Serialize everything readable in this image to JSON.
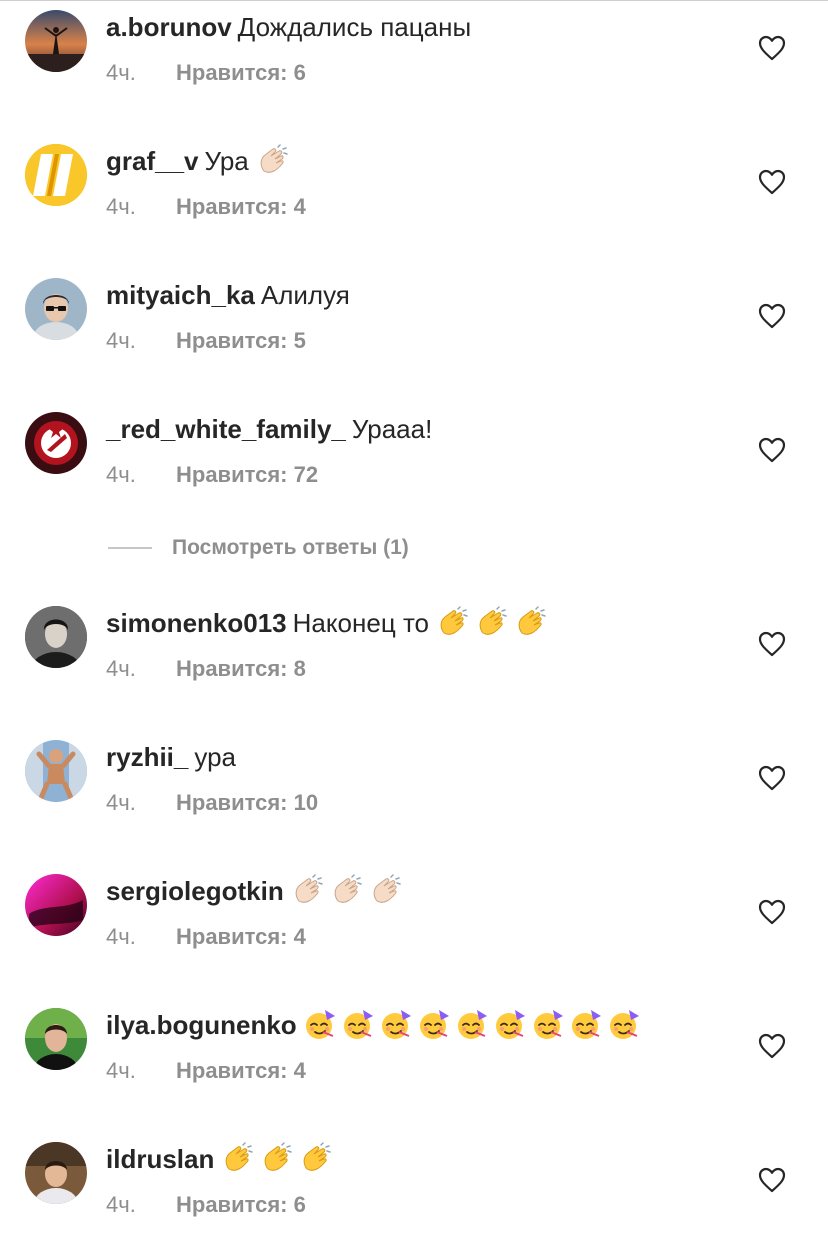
{
  "comments": [
    {
      "username": "a.borunov",
      "text": "Дождались пацаны",
      "emojis": [],
      "time": "4ч.",
      "likes": "Нравится: 6"
    },
    {
      "username": "graf__v",
      "text": "Ура",
      "emojis": [
        "clap-light-icon"
      ],
      "time": "4ч.",
      "likes": "Нравится: 4"
    },
    {
      "username": "mityaich_ka",
      "text": "Алилуя",
      "emojis": [],
      "time": "4ч.",
      "likes": "Нравится: 5"
    },
    {
      "username": "_red_white_family_",
      "text": "Урааа!",
      "emojis": [],
      "time": "4ч.",
      "likes": "Нравится: 72"
    },
    {
      "username": "simonenko013",
      "text": "Наконец то",
      "emojis": [
        "clap-yellow-icon",
        "clap-yellow-icon",
        "clap-yellow-icon"
      ],
      "time": "4ч.",
      "likes": "Нравится: 8"
    },
    {
      "username": "ryzhii_",
      "text": "ура",
      "emojis": [],
      "time": "4ч.",
      "likes": "Нравится: 10"
    },
    {
      "username": "sergiolegotkin",
      "text": "",
      "emojis": [
        "clap-light-icon",
        "clap-light-icon",
        "clap-light-icon"
      ],
      "time": "4ч.",
      "likes": "Нравится: 4"
    },
    {
      "username": "ilya.bogunenko",
      "text": "",
      "emojis": [
        "partying-face-icon",
        "partying-face-icon",
        "partying-face-icon",
        "partying-face-icon",
        "partying-face-icon",
        "partying-face-icon",
        "partying-face-icon",
        "partying-face-icon",
        "partying-face-icon"
      ],
      "time": "4ч.",
      "likes": "Нравится: 4"
    },
    {
      "username": "ildruslan",
      "text": "",
      "emojis": [
        "clap-yellow-icon",
        "clap-yellow-icon",
        "clap-yellow-icon"
      ],
      "time": "4ч.",
      "likes": "Нравится: 6"
    }
  ],
  "view_replies": {
    "label": "Посмотреть ответы (1)"
  },
  "colors": {
    "text": "#262626",
    "meta": "#8e8e8e",
    "divider": "#c7c7c7"
  }
}
